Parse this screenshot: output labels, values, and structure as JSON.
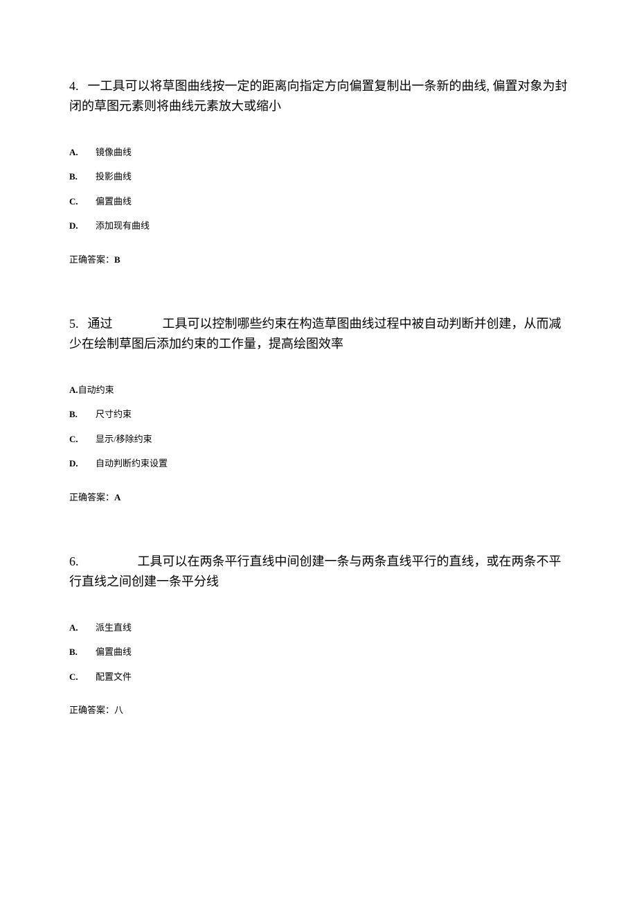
{
  "questions": [
    {
      "number": "4.",
      "text": "一工具可以将草图曲线按一定的距离向指定方向偏置复制出一条新的曲线, 偏置对象为封闭的草图元素则将曲线元素放大或缩小",
      "options": [
        {
          "letter": "A.",
          "text": "镜像曲线",
          "inline": false
        },
        {
          "letter": "B.",
          "text": "投影曲线",
          "inline": false
        },
        {
          "letter": "C.",
          "text": "偏置曲线",
          "inline": false
        },
        {
          "letter": "D.",
          "text": "添加现有曲线",
          "inline": false
        }
      ],
      "answer_label": "正确答案：",
      "answer_value": "B"
    },
    {
      "number": "5.",
      "text": "通过　　　　工具可以控制哪些约束在构造草图曲线过程中被自动判断并创建，从而减少在绘制草图后添加约束的工作量，提高绘图效率",
      "options": [
        {
          "letter": "A.",
          "text": "自动约束",
          "inline": true
        },
        {
          "letter": "B.",
          "text": "尺寸约束",
          "inline": false
        },
        {
          "letter": "C.",
          "text": "显示/移除约束",
          "inline": false
        },
        {
          "letter": "D.",
          "text": "自动判断约束设置",
          "inline": false
        }
      ],
      "answer_label": "正确答案：",
      "answer_value": "A"
    },
    {
      "number": "6.",
      "text": "　　　　工具可以在两条平行直线中间创建一条与两条直线平行的直线，或在两条不平行直线之间创建一条平分线",
      "options": [
        {
          "letter": "A.",
          "text": "派生直线",
          "inline": false
        },
        {
          "letter": "B.",
          "text": "偏置曲线",
          "inline": false
        },
        {
          "letter": "C.",
          "text": "配置文件",
          "inline": false
        }
      ],
      "answer_label": "正确答案：",
      "answer_value": "八"
    }
  ]
}
